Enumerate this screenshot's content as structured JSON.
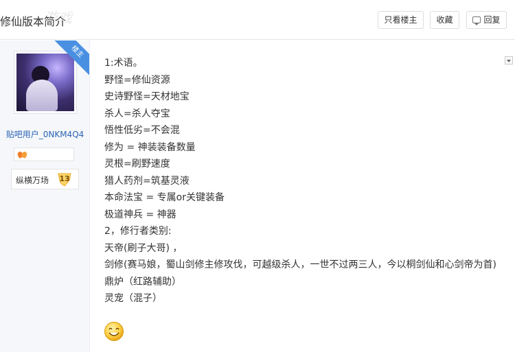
{
  "header": {
    "title": "修仙版本简介",
    "watermark": "游戏",
    "btn_only_op": "只看楼主",
    "btn_collect": "收藏",
    "btn_reply": "回复"
  },
  "sidebar": {
    "ribbon": "楼主",
    "username": "贴吧用户_0NKM4Q4",
    "badge_name": "纵横万场",
    "level": "13"
  },
  "post": {
    "lines": [
      "1:术语。",
      "野怪=修仙资源",
      "史诗野怪=天材地宝",
      "杀人=杀人夺宝",
      "悟性低劣=不会混",
      "修为 = 神装装备数量",
      "灵根=刷野速度",
      "猎人药剂=筑基灵液",
      "本命法宝 = 专属or关键装备",
      "极道神兵 = 神器",
      "2，修行者类别:",
      "天帝(刷子大哥) ，",
      "剑修(赛马娘，蜀山剑修主修攻伐，可越级杀人，一世不过两三人，今以桐剑仙和心剑帝为首)",
      "鼎炉（红路辅助）",
      "灵宠（混子）"
    ]
  },
  "colors": {
    "accent": "#4a90e2",
    "username": "#2d64b3",
    "sidebar_bg": "#f5f7fa"
  },
  "icons": {
    "reply": "reply-icon",
    "collapse": "chevron-down-icon",
    "emoji": "smile-emoji-icon"
  }
}
